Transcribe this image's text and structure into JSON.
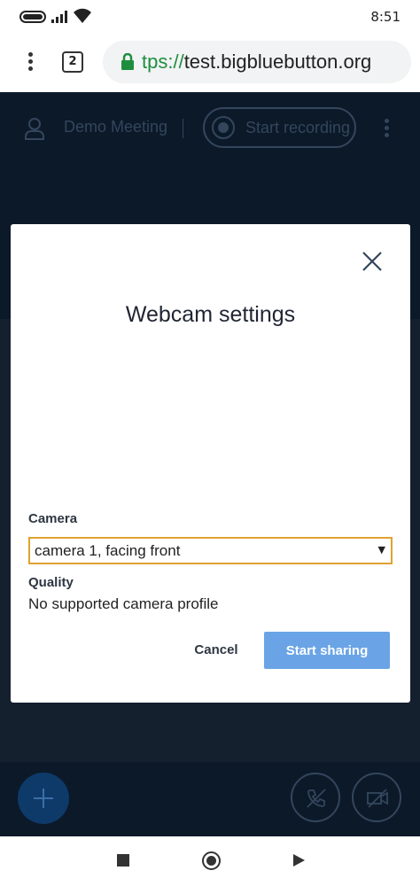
{
  "status_bar": {
    "time": "8:51"
  },
  "browser": {
    "tab_count": "2",
    "url_scheme": "tps://",
    "url_host": "test.bigbluebutton.org"
  },
  "header": {
    "meeting_title": "Demo Meeting",
    "record_label": "Start recording"
  },
  "modal": {
    "title": "Webcam settings",
    "camera_label": "Camera",
    "camera_value": "camera 1, facing front",
    "quality_label": "Quality",
    "quality_value": "No supported camera profile",
    "cancel_label": "Cancel",
    "share_label": "Start sharing"
  },
  "colors": {
    "accent": "#6aa4e6",
    "select_focus": "#e0a230",
    "backdrop": "#0c1929"
  }
}
